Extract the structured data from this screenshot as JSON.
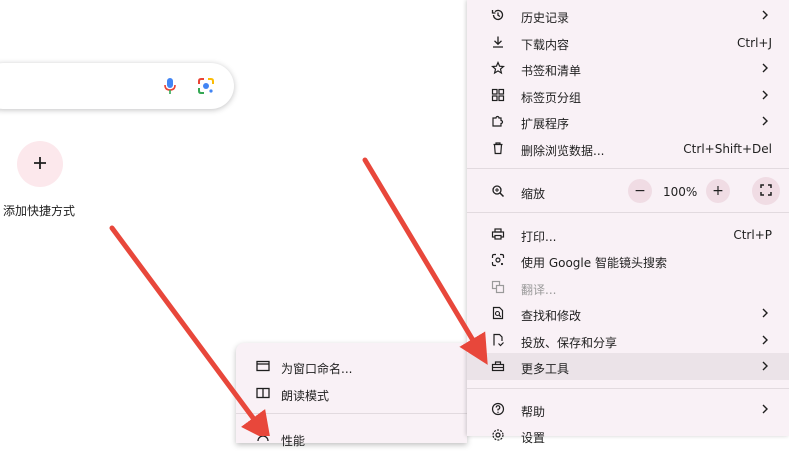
{
  "new_tab": {
    "shortcut_label": "添加快捷方式"
  },
  "main_menu": {
    "items_top": [
      {
        "label": "历史记录",
        "icon": "history-icon",
        "chevron": true
      },
      {
        "label": "下载内容",
        "icon": "download-icon",
        "shortcut": "Ctrl+J"
      },
      {
        "label": "书签和清单",
        "icon": "star-icon",
        "chevron": true
      },
      {
        "label": "标签页分组",
        "icon": "tab-groups-icon",
        "chevron": true
      },
      {
        "label": "扩展程序",
        "icon": "puzzle-icon",
        "chevron": true
      },
      {
        "label": "删除浏览数据...",
        "icon": "trash-icon",
        "shortcut": "Ctrl+Shift+Del"
      }
    ],
    "zoom": {
      "label": "缩放",
      "minus": "−",
      "value": "100%",
      "plus": "+"
    },
    "items_mid": [
      {
        "label": "打印...",
        "icon": "print-icon",
        "shortcut": "Ctrl+P"
      },
      {
        "label": "使用 Google 智能镜头搜索",
        "icon": "lens-icon"
      },
      {
        "label": "翻译...",
        "icon": "translate-icon",
        "disabled": true
      },
      {
        "label": "查找和修改",
        "icon": "find-icon",
        "chevron": true
      },
      {
        "label": "投放、保存和分享",
        "icon": "cast-icon",
        "chevron": true
      },
      {
        "label": "更多工具",
        "icon": "toolbox-icon",
        "chevron": true,
        "highlighted": true
      }
    ],
    "items_bottom": [
      {
        "label": "帮助",
        "icon": "help-icon",
        "chevron": true
      },
      {
        "label": "设置",
        "icon": "settings-icon"
      }
    ]
  },
  "more_tools_submenu": {
    "items": [
      {
        "label": "为窗口命名...",
        "icon": "window-icon"
      },
      {
        "label": "朗读模式",
        "icon": "reading-mode-icon"
      },
      {
        "label": "性能",
        "icon": "performance-icon"
      }
    ]
  },
  "colors": {
    "menu_bg": "#f9f1f6",
    "highlight": "#ebe3e8",
    "arrow": "#e8473b",
    "shortcut_bg": "#fce8ec"
  }
}
